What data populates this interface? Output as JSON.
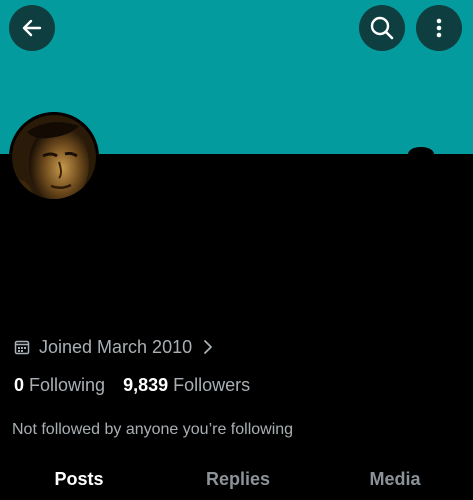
{
  "colors": {
    "banner": "#049b9e",
    "button_bg": "#0f3e40",
    "background": "#000000",
    "text_primary": "#ffffff",
    "text_secondary": "#a9b0b5"
  },
  "header": {
    "back_icon": "arrow-left-icon",
    "search_icon": "search-icon",
    "more_icon": "more-vertical-icon"
  },
  "profile": {
    "joined_text": "Joined March 2010",
    "joined_icon": "calendar-icon",
    "following_count": "0",
    "following_label": "Following",
    "followers_count": "9,839",
    "followers_label": "Followers",
    "not_followed_text": "Not followed by anyone you’re following"
  },
  "tabs": [
    {
      "label": "Posts",
      "active": true
    },
    {
      "label": "Replies",
      "active": false
    },
    {
      "label": "Media",
      "active": false
    }
  ]
}
